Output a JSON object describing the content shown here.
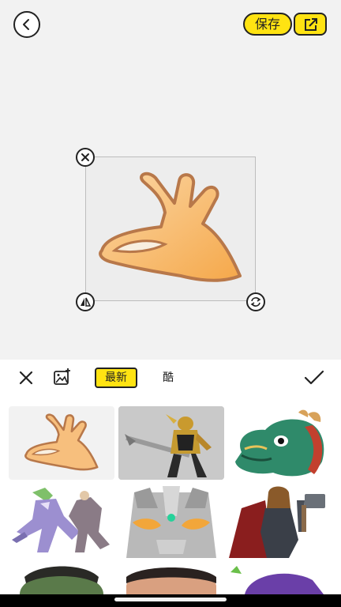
{
  "header": {
    "save_label": "保存"
  },
  "toolbar": {
    "tab_latest": "最新",
    "tab_cool": "酷"
  },
  "icons": {
    "back": "chevron-left-icon",
    "share": "share-external-icon",
    "close": "close-icon",
    "flip": "flip-icon",
    "rotate": "rotate-icon",
    "add_image": "add-image-icon",
    "confirm": "check-icon"
  },
  "colors": {
    "accent": "#ffe312",
    "outline": "#222222"
  },
  "stickers": [
    "hand-ok-sticker",
    "armored-knight-figure",
    "green-dragon-head",
    "purple-anime-character",
    "ultraman-face",
    "thor-with-hammer",
    "hulk-face-partial",
    "man-face-partial",
    "purple-cartoon-partial"
  ]
}
